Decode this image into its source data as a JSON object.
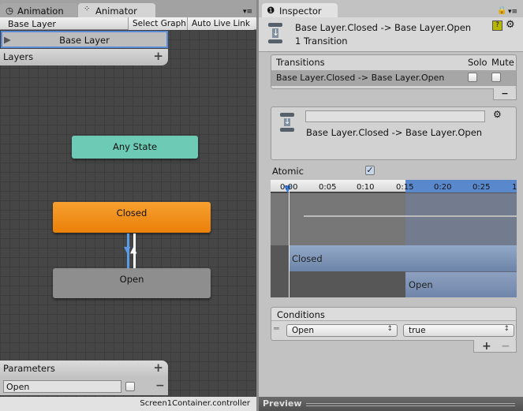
{
  "left": {
    "tabs": [
      {
        "label": "Animation",
        "icon": "clock-icon"
      },
      {
        "label": "Animator",
        "icon": "animator-icon"
      }
    ],
    "breadcrumb": "Base Layer",
    "select_graph": "Select Graph",
    "auto_live_link": "Auto Live Link",
    "layer_name": "Base Layer",
    "layers_label": "Layers",
    "add": "+",
    "nodes": {
      "any_state": "Any State",
      "closed": "Closed",
      "open": "Open"
    },
    "parameters_label": "Parameters",
    "parameter": {
      "name": "Open",
      "value": false
    },
    "remove": "−",
    "status": "Screen1Container.controller"
  },
  "right": {
    "tab": "Inspector",
    "header_title": "Base Layer.Closed -> Base Layer.Open",
    "header_sub": "1 Transition",
    "transitions": {
      "header": "Transitions",
      "solo": "Solo",
      "mute": "Mute",
      "row": "Base Layer.Closed -> Base Layer.Open",
      "remove": "−"
    },
    "transition_name_field": "",
    "transition_label": "Base Layer.Closed -> Base Layer.Open",
    "atomic_label": "Atomic",
    "atomic": true,
    "timeline": {
      "ticks": [
        "0:00",
        "0:05",
        "0:10",
        "0:15",
        "0:20",
        "0:25",
        "1"
      ],
      "from_state": "Closed",
      "to_state": "Open"
    },
    "conditions": {
      "header": "Conditions",
      "param": "Open",
      "value": "true",
      "add": "+",
      "remove": "−"
    },
    "preview": "Preview"
  },
  "colors": {
    "any_state": "#6ccab5",
    "closed": "#f08c10",
    "open": "#8e8e8e",
    "selection": "#5b8ad6"
  }
}
